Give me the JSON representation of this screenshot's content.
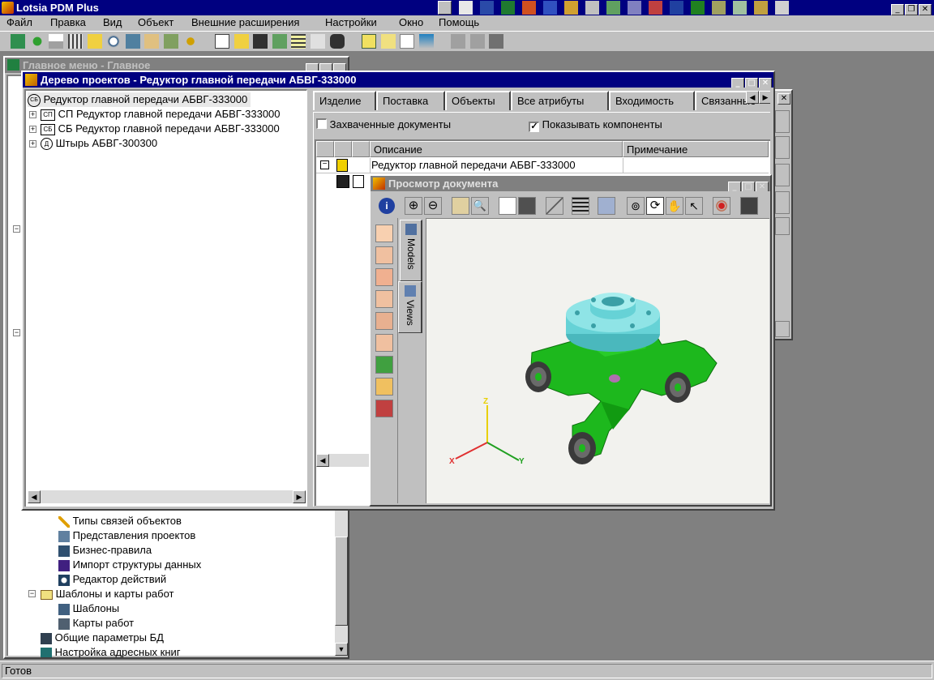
{
  "app": {
    "title": "Lotsia PDM Plus"
  },
  "menu": [
    "Файл",
    "Правка",
    "Вид",
    "Объект",
    "Внешние расширения",
    "Настройки",
    "Окно",
    "Помощь"
  ],
  "main_menu_window": {
    "title": "Главное меню - Главное",
    "items": [
      {
        "label": "Типы связей объектов",
        "icon": "pencil-icon"
      },
      {
        "label": "Представления проектов",
        "icon": "project-view-icon"
      },
      {
        "label": "Бизнес-правила",
        "icon": "rules-icon"
      },
      {
        "label": "Импорт структуры данных",
        "icon": "import-icon"
      },
      {
        "label": "Редактор действий",
        "icon": "actions-icon"
      },
      {
        "label": "Шаблоны и карты работ",
        "icon": "folder-icon"
      },
      {
        "label": "Шаблоны",
        "icon": "templates-icon"
      },
      {
        "label": "Карты работ",
        "icon": "work-cards-icon"
      },
      {
        "label": "Общие параметры БД",
        "icon": "db-params-icon"
      },
      {
        "label": "Настройка адресных книг",
        "icon": "address-book-icon"
      }
    ]
  },
  "project_tree_window": {
    "title": "Дерево проектов - Редуктор главной передачи АБВГ-333000",
    "tree": [
      {
        "badge": "СБ",
        "label": "Редуктор главной передачи АБВГ-333000"
      },
      {
        "badge": "СП",
        "label": "СП Редуктор главной передачи АБВГ-333000"
      },
      {
        "badge": "СБ",
        "label": "СБ Редуктор главной передачи АБВГ-333000"
      },
      {
        "badge": "Д",
        "label": "Штырь  АБВГ-300300"
      }
    ],
    "tabs": [
      "Изделие",
      "Поставка",
      "Объекты",
      "Все атрибуты",
      "Входимость",
      "Связанные"
    ],
    "checkbox_captured": {
      "label": "Захваченные документы",
      "checked": false
    },
    "checkbox_components": {
      "label": "Показывать компоненты",
      "checked": true
    },
    "columns": [
      "Описание",
      "Примечание"
    ],
    "rows": [
      {
        "description": "Редуктор главной передачи АБВГ-333000",
        "note": ""
      }
    ]
  },
  "viewer_window": {
    "title": "Просмотр документа",
    "side_tabs": [
      "Models",
      "Views"
    ],
    "axes": {
      "x": "X",
      "y": "Y",
      "z": "Z"
    }
  },
  "status_bar": {
    "text": "Готов"
  },
  "colors": {
    "title_active": "#000080",
    "title_inactive": "#808080",
    "model_green": "#1db81d",
    "model_cyan": "#66d2d6",
    "canvas": "#f2f2ee"
  }
}
